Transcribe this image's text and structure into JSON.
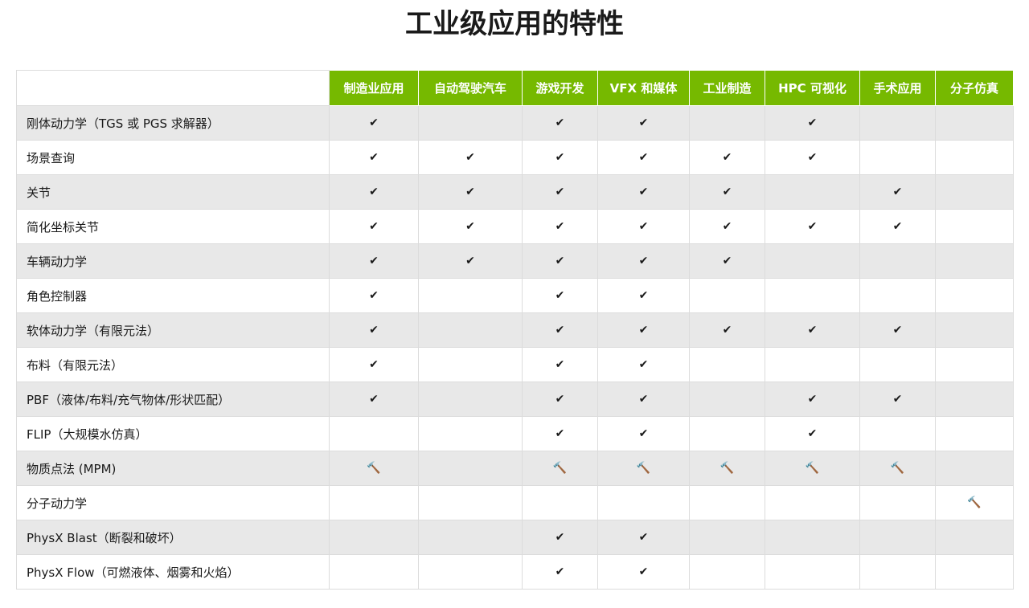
{
  "page": {
    "title": "工业级应用的特性"
  },
  "table": {
    "columns": [
      "制造业应用",
      "自动驾驶汽车",
      "游戏开发",
      "VFX 和媒体",
      "工业制造",
      "HPC 可视化",
      "手术应用",
      "分子仿真"
    ],
    "legend": {
      "check": "✔",
      "hammer": "🔨"
    },
    "rows": [
      {
        "feature": "刚体动力学（TGS 或 PGS 求解器）",
        "marks": [
          "check",
          "",
          "check",
          "check",
          "",
          "check",
          "",
          ""
        ]
      },
      {
        "feature": "场景查询",
        "marks": [
          "check",
          "check",
          "check",
          "check",
          "check",
          "check",
          "",
          ""
        ]
      },
      {
        "feature": "关节",
        "marks": [
          "check",
          "check",
          "check",
          "check",
          "check",
          "",
          "check",
          ""
        ]
      },
      {
        "feature": "简化坐标关节",
        "marks": [
          "check",
          "check",
          "check",
          "check",
          "check",
          "check",
          "check",
          ""
        ]
      },
      {
        "feature": "车辆动力学",
        "marks": [
          "check",
          "check",
          "check",
          "check",
          "check",
          "",
          "",
          ""
        ]
      },
      {
        "feature": "角色控制器",
        "marks": [
          "check",
          "",
          "check",
          "check",
          "",
          "",
          "",
          ""
        ]
      },
      {
        "feature": "软体动力学（有限元法）",
        "marks": [
          "check",
          "",
          "check",
          "check",
          "check",
          "check",
          "check",
          ""
        ]
      },
      {
        "feature": "布料（有限元法）",
        "marks": [
          "check",
          "",
          "check",
          "check",
          "",
          "",
          "",
          ""
        ]
      },
      {
        "feature": "PBF（液体/布料/充气物体/形状匹配）",
        "marks": [
          "check",
          "",
          "check",
          "check",
          "",
          "check",
          "check",
          ""
        ]
      },
      {
        "feature": "FLIP（大规模水仿真）",
        "marks": [
          "",
          "",
          "check",
          "check",
          "",
          "check",
          "",
          ""
        ]
      },
      {
        "feature": "物质点法 (MPM)",
        "marks": [
          "hammer",
          "",
          "hammer",
          "hammer",
          "hammer",
          "hammer",
          "hammer",
          ""
        ]
      },
      {
        "feature": "分子动力学",
        "marks": [
          "",
          "",
          "",
          "",
          "",
          "",
          "",
          "hammer"
        ]
      },
      {
        "feature": "PhysX Blast（断裂和破坏）",
        "marks": [
          "",
          "",
          "check",
          "check",
          "",
          "",
          "",
          ""
        ]
      },
      {
        "feature": "PhysX Flow（可燃液体、烟雾和火焰）",
        "marks": [
          "",
          "",
          "check",
          "check",
          "",
          "",
          "",
          ""
        ]
      }
    ]
  },
  "colors": {
    "header_green": "#76b900",
    "stripe_gray": "#e8e8e8",
    "border": "#dcdcdc"
  }
}
